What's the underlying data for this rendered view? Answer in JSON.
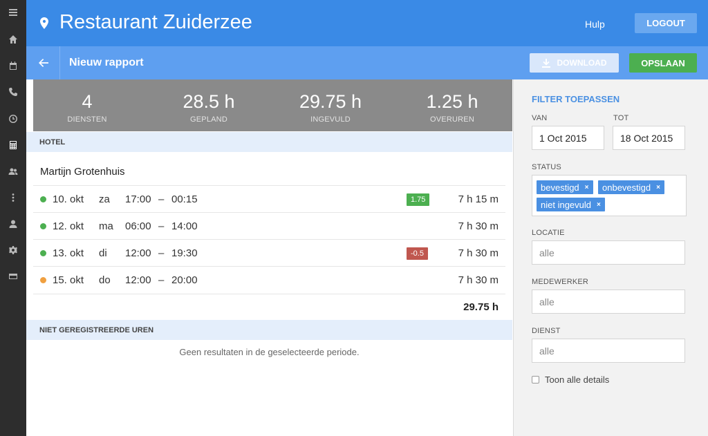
{
  "sidebar": {
    "icons": [
      "menu-icon",
      "home-icon",
      "calendar-icon",
      "phone-icon",
      "clock-icon",
      "calculator-icon",
      "users-icon",
      "more-vertical-icon",
      "user-icon",
      "gear-icon",
      "card-icon"
    ]
  },
  "header": {
    "title": "Restaurant Zuiderzee",
    "help": "Hulp",
    "logout": "LOGOUT"
  },
  "subheader": {
    "title": "Nieuw rapport",
    "download": "DOWNLOAD",
    "save": "OPSLAAN"
  },
  "stats": [
    {
      "value": "4",
      "label": "DIENSTEN"
    },
    {
      "value": "28.5 h",
      "label": "GEPLAND"
    },
    {
      "value": "29.75 h",
      "label": "INGEVULD"
    },
    {
      "value": "1.25 h",
      "label": "OVERUREN"
    }
  ],
  "hotel": {
    "section": "HOTEL",
    "employee": "Martijn Grotenhuis",
    "shifts": [
      {
        "date": "10. okt",
        "day": "za",
        "start": "17:00",
        "end": "00:15",
        "badge": "1.75",
        "duration": "7 h 15 m",
        "status_color": "#4caf50",
        "badge_color": "#4caf50"
      },
      {
        "date": "12. okt",
        "day": "ma",
        "start": "06:00",
        "end": "14:00",
        "badge": "",
        "duration": "7 h 30 m",
        "status_color": "#4caf50",
        "badge_color": ""
      },
      {
        "date": "13. okt",
        "day": "di",
        "start": "12:00",
        "end": "19:30",
        "badge": "-0.5",
        "duration": "7 h 30 m",
        "status_color": "#4caf50",
        "badge_color": "#c0574f"
      },
      {
        "date": "15. okt",
        "day": "do",
        "start": "12:00",
        "end": "20:00",
        "badge": "",
        "duration": "7 h 30 m",
        "status_color": "#f0a040",
        "badge_color": ""
      }
    ],
    "dash": "–",
    "total": "29.75 h"
  },
  "unregistered": {
    "section": "NIET GEREGISTREERDE UREN",
    "empty": "Geen resultaten in de geselecteerde periode."
  },
  "filter": {
    "title": "FILTER TOEPASSEN",
    "from_label": "VAN",
    "from_value": "1 Oct 2015",
    "to_label": "TOT",
    "to_value": "18 Oct 2015",
    "status_label": "STATUS",
    "status_tags": [
      "bevestigd",
      "onbevestigd",
      "niet ingevuld"
    ],
    "location_label": "LOCATIE",
    "location_value": "alle",
    "employee_label": "MEDEWERKER",
    "employee_value": "alle",
    "service_label": "DIENST",
    "service_value": "alle",
    "details_label": "Toon alle details",
    "tag_remove": "×"
  }
}
